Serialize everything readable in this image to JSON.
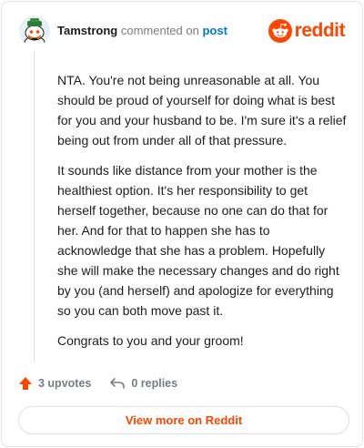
{
  "header": {
    "username": "Tamstrong",
    "commented_text": "commented on",
    "post_link": "post",
    "brand_wordmark": "reddit"
  },
  "comment": {
    "paragraphs": [
      "NTA. You're not being unreasonable at all. You should be proud of yourself for doing what is best for you and your husband to be. I'm sure it's a relief being out from under all of that pressure.",
      "It sounds like distance from your mother is the healthiest option. It's her responsibility to get herself together, because no one can do that for her. And for that to happen she has to acknowledge that she has a problem. Hopefully she will make the necessary changes and do right by you (and herself) and apologize for everything so you can both move past it.",
      "Congrats to you and your groom!"
    ]
  },
  "actions": {
    "upvotes": "3 upvotes",
    "replies": "0 replies"
  },
  "footer": {
    "view_more": "View more on Reddit"
  },
  "colors": {
    "accent": "#ff4500",
    "link": "#0079d3",
    "muted": "#787c7e"
  },
  "icons": {
    "avatar": "snoo-avatar",
    "brand": "reddit-logo-icon",
    "upvote": "upvote-arrow-icon",
    "reply": "reply-arrow-icon"
  }
}
